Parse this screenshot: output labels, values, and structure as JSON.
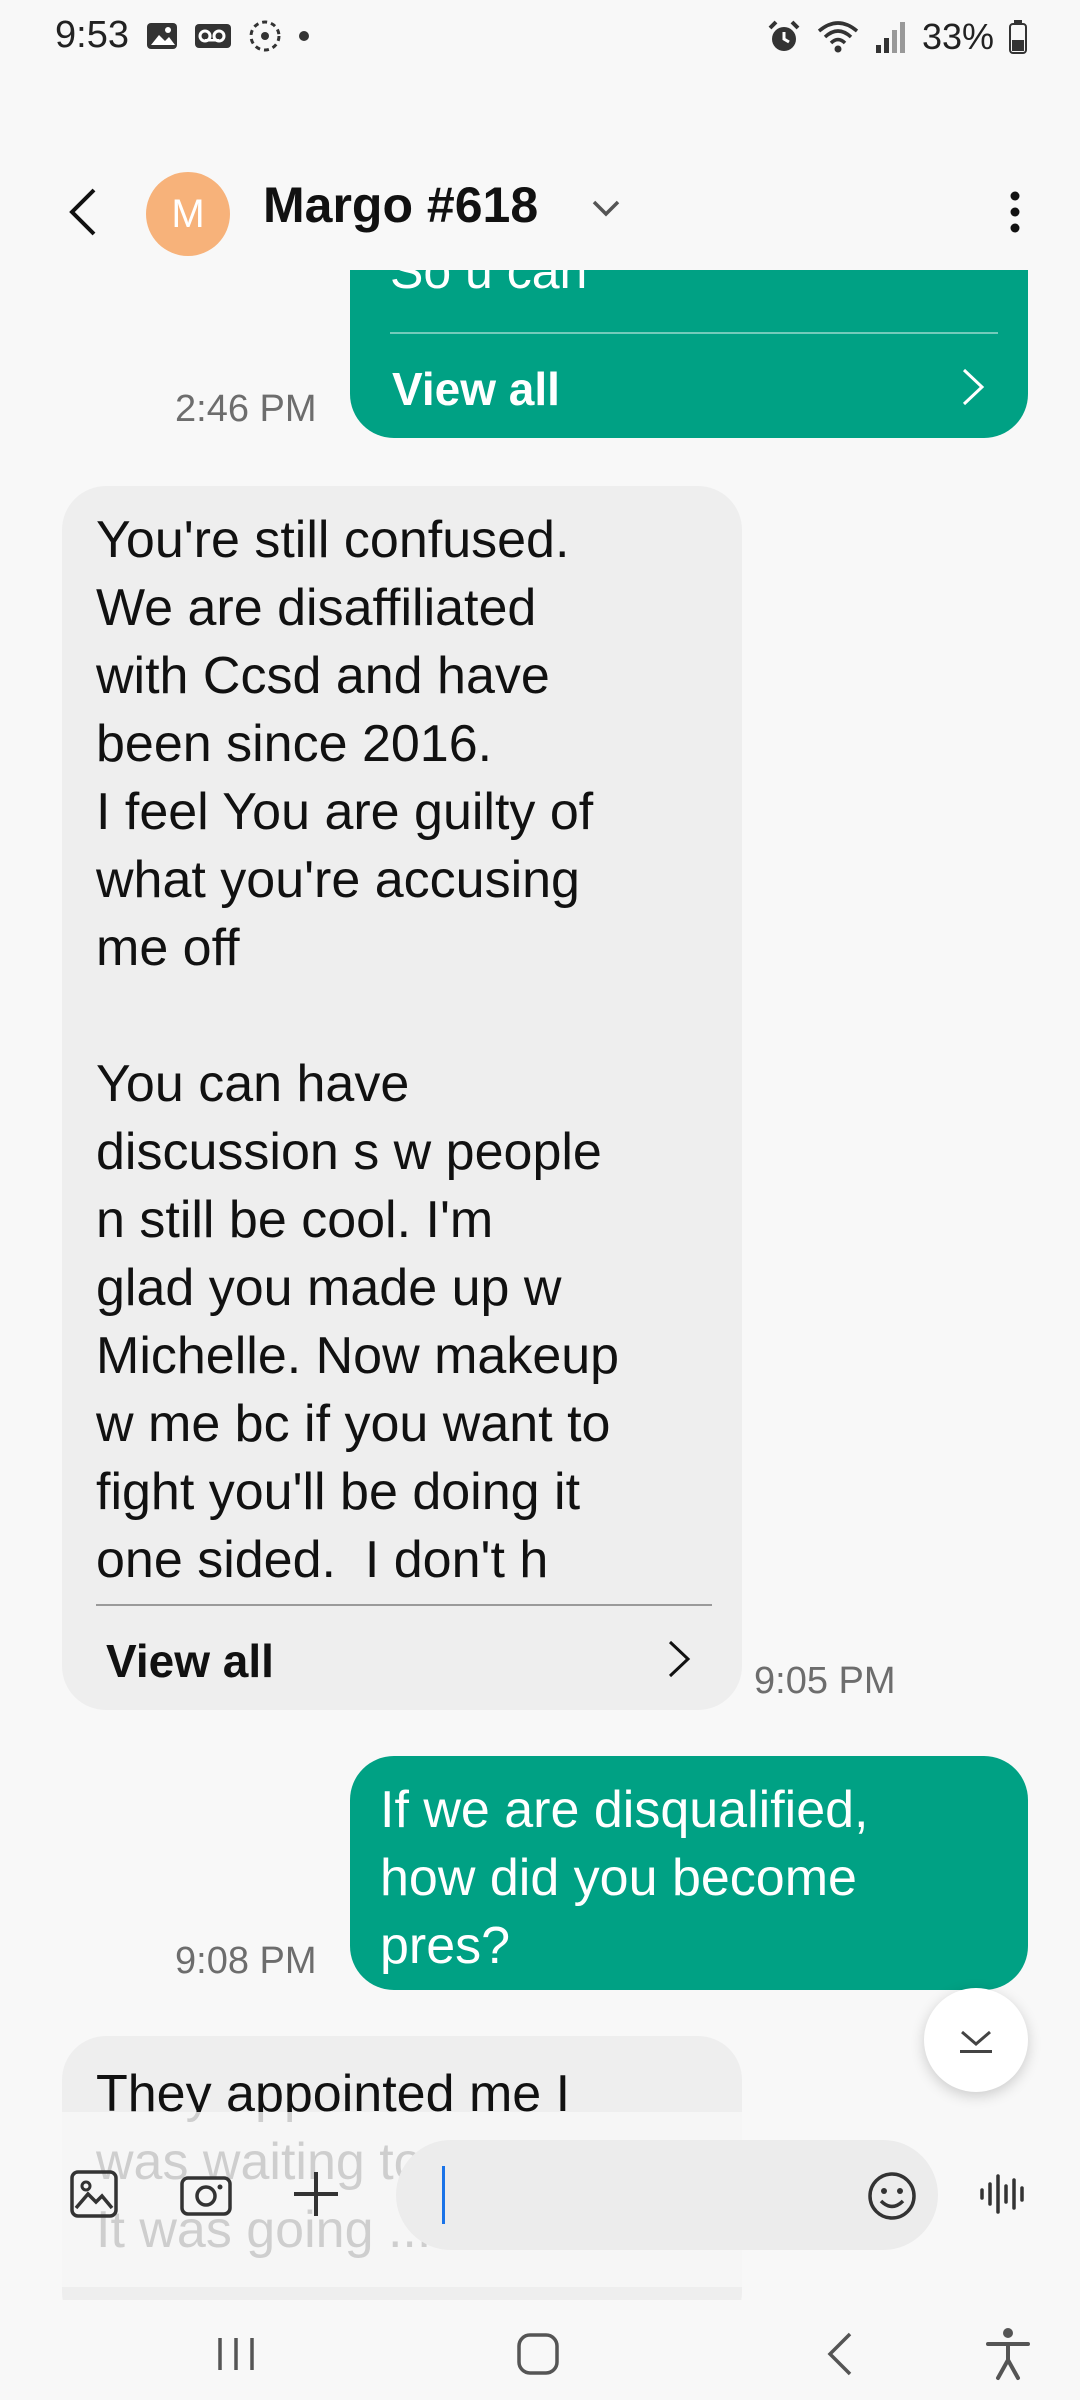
{
  "status_bar": {
    "time": "9:53",
    "battery": "33%"
  },
  "header": {
    "avatar_letter": "M",
    "contact_name": "Margo #618"
  },
  "messages": [
    {
      "direction": "sent",
      "text_clipped": "So u can",
      "view_all": "View all",
      "time": "2:46 PM"
    },
    {
      "direction": "received",
      "text": "You're still confused.\nWe are disaffiliated\nwith Ccsd and have\nbeen since 2016.\nI feel You are guilty of\nwhat you're accusing\nme off\n\nYou can have\ndiscussion s w people\nn still be cool. I'm\nglad you made up w\nMichelle. Now makeup\nw me bc if you want to\nfight you'll be doing it\none sided.  I don't h",
      "view_all": "View all",
      "time": "9:05 PM"
    },
    {
      "direction": "sent",
      "text": "If we are disqualified,\nhow did you become\npres?",
      "time": "9:08 PM"
    },
    {
      "direction": "received",
      "text": "They appointed me I\nwas waiting to ...\nIt was going ..."
    }
  ],
  "composer": {
    "input_value": ""
  }
}
